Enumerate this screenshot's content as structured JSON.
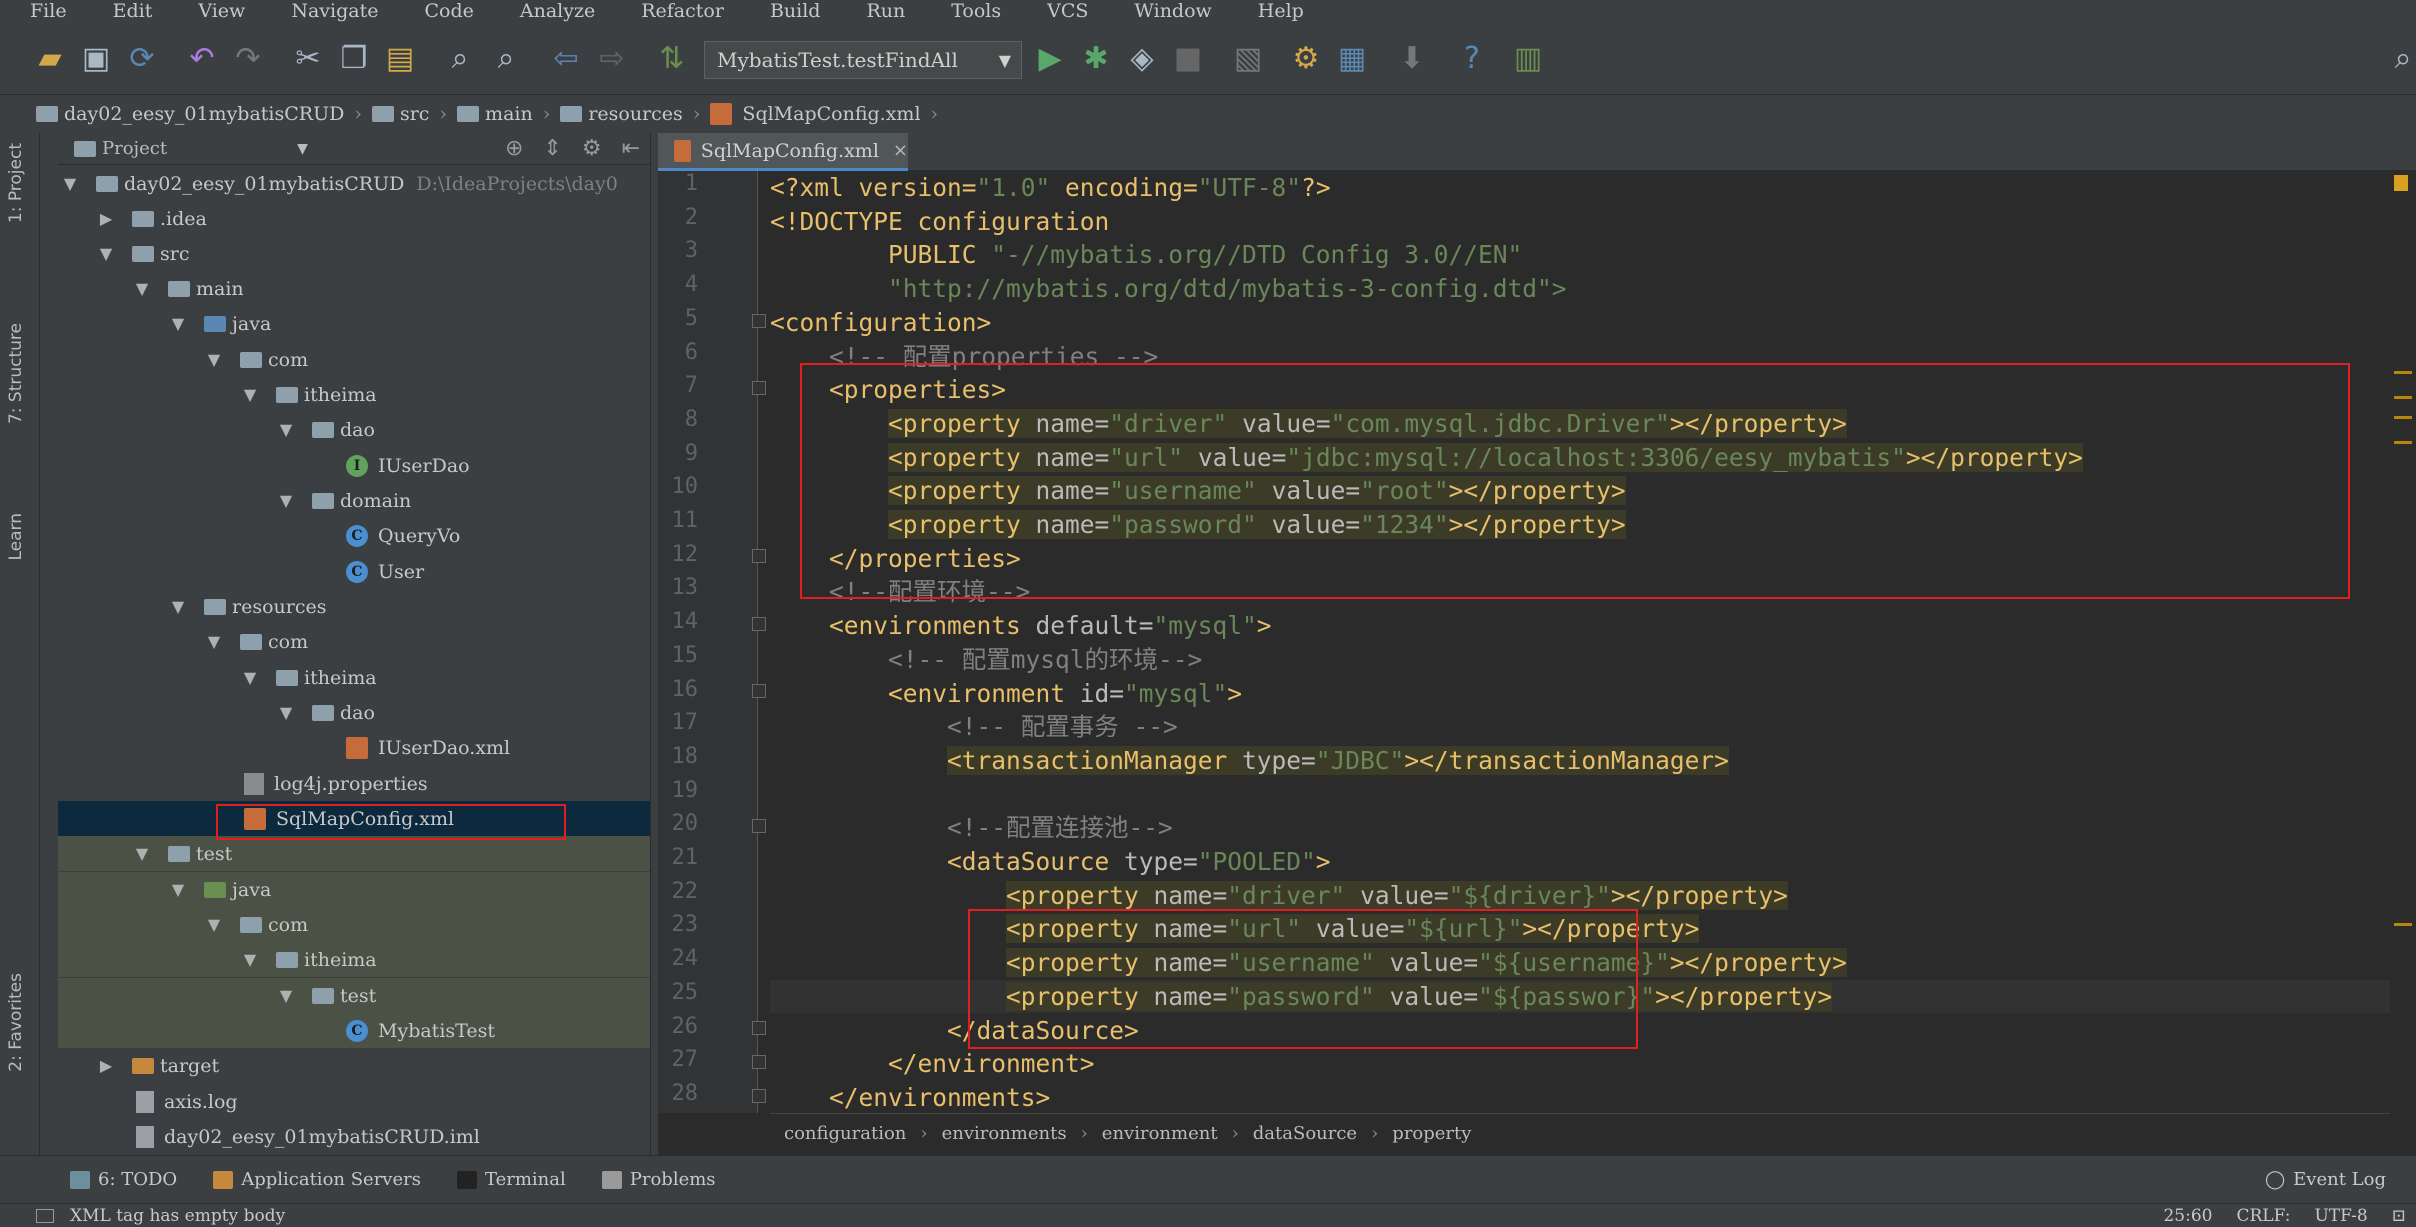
{
  "menu": [
    "File",
    "Edit",
    "View",
    "Navigate",
    "Code",
    "Analyze",
    "Refactor",
    "Build",
    "Run",
    "Tools",
    "VCS",
    "Window",
    "Help"
  ],
  "toolbar": {
    "run_config": "MybatisTest.testFindAll",
    "icons": [
      "open-icon",
      "save-icon",
      "sync-icon",
      "undo-icon",
      "redo-icon",
      "cut-icon",
      "copy-icon",
      "paste-icon",
      "find-icon",
      "replace-icon",
      "back-icon",
      "forward-icon",
      "build-icon",
      "run-icon",
      "debug-icon",
      "coverage-icon",
      "stop-icon",
      "project-structure-icon",
      "settings-icon",
      "sdk-icon",
      "vcs-icon",
      "help-icon",
      "db-icon"
    ]
  },
  "nav": {
    "crumbs": [
      "day02_eesy_01mybatisCRUD",
      "src",
      "main",
      "resources",
      "SqlMapConfig.xml"
    ]
  },
  "side_tabs": {
    "project": "1: Project",
    "structure": "7: Structure",
    "learn": "Learn",
    "favorites": "2: Favorites"
  },
  "project": {
    "title": "Project",
    "items": [
      {
        "label": "day02_eesy_01mybatisCRUD",
        "path": "D:\\IdeaProjects\\day0"
      },
      {
        "label": ".idea"
      },
      {
        "label": "src"
      },
      {
        "label": "main"
      },
      {
        "label": "java"
      },
      {
        "label": "com"
      },
      {
        "label": "itheima"
      },
      {
        "label": "dao"
      },
      {
        "label": "IUserDao"
      },
      {
        "label": "domain"
      },
      {
        "label": "QueryVo"
      },
      {
        "label": "User"
      },
      {
        "label": "resources"
      },
      {
        "label": "com"
      },
      {
        "label": "itheima"
      },
      {
        "label": "dao"
      },
      {
        "label": "IUserDao.xml"
      },
      {
        "label": "log4j.properties"
      },
      {
        "label": "SqlMapConfig.xml"
      },
      {
        "label": "test"
      },
      {
        "label": "java"
      },
      {
        "label": "com"
      },
      {
        "label": "itheima"
      },
      {
        "label": "test"
      },
      {
        "label": "MybatisTest"
      },
      {
        "label": "target"
      },
      {
        "label": "axis.log"
      },
      {
        "label": "day02_eesy_01mybatisCRUD.iml"
      }
    ]
  },
  "editor": {
    "tab": "SqlMapConfig.xml",
    "lines": [
      "1",
      "2",
      "3",
      "4",
      "5",
      "6",
      "7",
      "8",
      "9",
      "10",
      "11",
      "12",
      "13",
      "14",
      "15",
      "16",
      "17",
      "18",
      "19",
      "20",
      "21",
      "22",
      "23",
      "24",
      "25",
      "26",
      "27",
      "28"
    ],
    "code": {
      "l1a": "<?xml version=",
      "l1b": "\"1.0\"",
      "l1c": " encoding=",
      "l1d": "\"UTF-8\"",
      "l1e": "?>",
      "l2": "<!DOCTYPE configuration",
      "l3a": "        PUBLIC ",
      "l3b": "\"-//mybatis.org//DTD Config 3.0//EN\"",
      "l4": "        \"http://mybatis.org/dtd/mybatis-3-config.dtd\">",
      "l5": "<configuration>",
      "l6": "    <!-- 配置properties -->",
      "l7": "    <properties>",
      "l8a": "<property ",
      "l8b": "name=",
      "l8c": "\"driver\"",
      "l8d": " value=",
      "l8e": "\"com.mysql.jdbc.Driver\"",
      "l8f": "></property>",
      "l9a": "<property ",
      "l9b": "name=",
      "l9c": "\"url\"",
      "l9d": " value=",
      "l9e": "\"jdbc:mysql://localhost:3306/eesy_mybatis\"",
      "l9f": "></property>",
      "l10a": "<property ",
      "l10b": "name=",
      "l10c": "\"username\"",
      "l10d": " value=",
      "l10e": "\"root\"",
      "l10f": "></property>",
      "l11a": "<property ",
      "l11b": "name=",
      "l11c": "\"password\"",
      "l11d": " value=",
      "l11e": "\"1234\"",
      "l11f": "></property>",
      "l12": "    </properties>",
      "l13": "    <!--配置环境-->",
      "l14a": "    <environments ",
      "l14b": "default=",
      "l14c": "\"mysql\"",
      "l14d": ">",
      "l15": "        <!-- 配置mysql的环境-->",
      "l16a": "        <environment ",
      "l16b": "id=",
      "l16c": "\"mysql\"",
      "l16d": ">",
      "l17": "            <!-- 配置事务 -->",
      "l18a": "<transactionManager ",
      "l18b": "type=",
      "l18c": "\"JDBC\"",
      "l18d": "></transactionManager>",
      "l20": "            <!--配置连接池-->",
      "l21a": "            <dataSource ",
      "l21b": "type=",
      "l21c": "\"POOLED\"",
      "l21d": ">",
      "l22a": "<property ",
      "l22b": "name=",
      "l22c": "\"driver\"",
      "l22d": " value=",
      "l22e": "\"${driver}\"",
      "l22f": "></property>",
      "l23a": "<property ",
      "l23b": "name=",
      "l23c": "\"url\"",
      "l23d": " value=",
      "l23e": "\"${url}\"",
      "l23f": "></property>",
      "l24a": "<property ",
      "l24b": "name=",
      "l24c": "\"username\"",
      "l24d": " value=",
      "l24e": "\"${username}\"",
      "l24f": "></property>",
      "l25a": "<property ",
      "l25b": "name=",
      "l25c": "\"password\"",
      "l25d": " value=",
      "l25e": "\"${passwor}\"",
      "l25f": "></property>",
      "l26": "            </dataSource>",
      "l27": "        </environment>",
      "l28": "    </environments>"
    },
    "breadcrumb": [
      "configuration",
      "environments",
      "environment",
      "dataSource",
      "property"
    ]
  },
  "bottom": {
    "todo": "6: TODO",
    "app_servers": "Application Servers",
    "terminal": "Terminal",
    "problems": "Problems",
    "event_log": "Event Log"
  },
  "status": {
    "message": "XML tag has empty body",
    "position": "25:60",
    "line_sep": "CRLF:",
    "encoding": "UTF-8"
  }
}
